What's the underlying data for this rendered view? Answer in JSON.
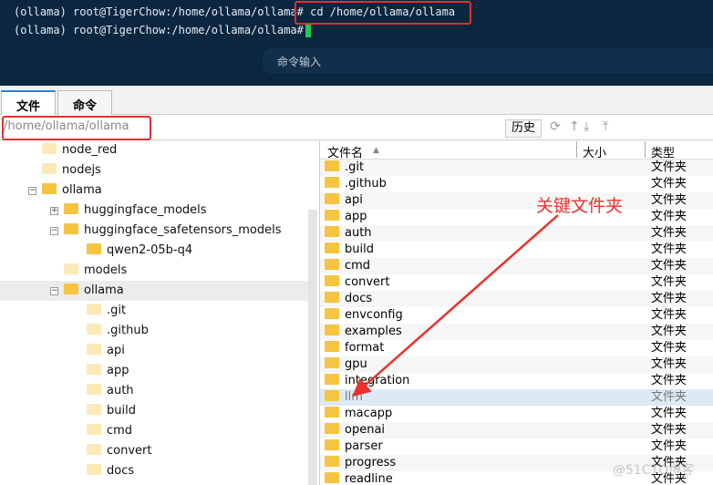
{
  "terminal": {
    "lines": [
      {
        "prompt": "(ollama) root@TigerChow:/home/ollama/ollama#",
        "cmd": "cd /home/ollama/ollama"
      },
      {
        "prompt": "(ollama) root@TigerChow:/home/ollama/ollama#",
        "cmd": ""
      }
    ],
    "command_input_placeholder": "命令输入"
  },
  "tabs": [
    {
      "label": "文件"
    },
    {
      "label": "命令"
    }
  ],
  "path": "/home/ollama/ollama",
  "toolbar": {
    "history": "历史"
  },
  "tree": [
    {
      "label": "node_red"
    },
    {
      "label": "nodejs"
    },
    {
      "label": "ollama"
    },
    {
      "label": "huggingface_models"
    },
    {
      "label": "huggingface_safetensors_models"
    },
    {
      "label": "qwen2-05b-q4"
    },
    {
      "label": "models"
    },
    {
      "label": "ollama"
    },
    {
      "label": ".git"
    },
    {
      "label": ".github"
    },
    {
      "label": "api"
    },
    {
      "label": "app"
    },
    {
      "label": "auth"
    },
    {
      "label": "build"
    },
    {
      "label": "cmd"
    },
    {
      "label": "convert"
    },
    {
      "label": "docs"
    }
  ],
  "columns": {
    "name": "文件名",
    "size": "大小",
    "type": "类型"
  },
  "files": [
    ".git",
    ".github",
    "api",
    "app",
    "auth",
    "build",
    "cmd",
    "convert",
    "docs",
    "envconfig",
    "examples",
    "format",
    "gpu",
    "integration",
    "llm",
    "macapp",
    "openai",
    "parser",
    "progress",
    "readline"
  ],
  "file_type": "文件夹",
  "annotation": "关键文件夹",
  "watermark": "@51CTO博客"
}
